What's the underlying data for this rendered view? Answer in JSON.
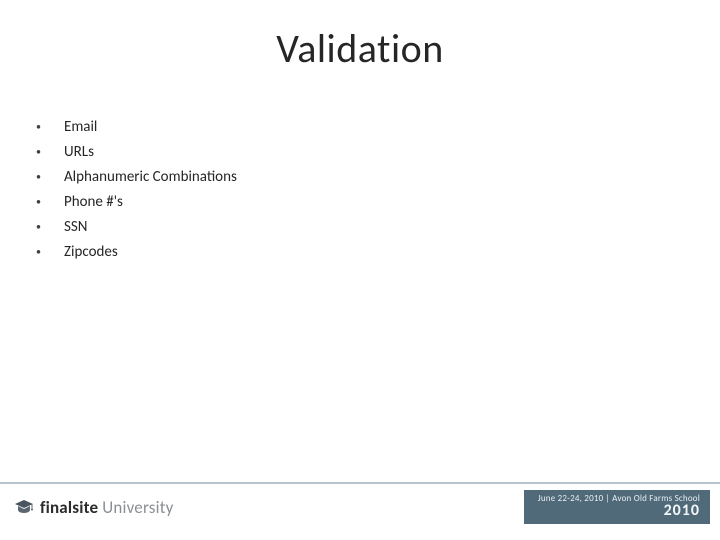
{
  "title": "Validation",
  "bullets": [
    "Email",
    "URLs",
    "Alphanumeric Combinations",
    "Phone #'s",
    "SSN",
    "Zipcodes"
  ],
  "footer": {
    "brand_strong": "finalsite",
    "brand_light": "University",
    "event_meta": "June 22-24, 2010 | Avon Old Farms School",
    "event_year": "2010"
  },
  "colors": {
    "footer_rule": "#b7c3cc",
    "event_bg": "#506a7a"
  }
}
